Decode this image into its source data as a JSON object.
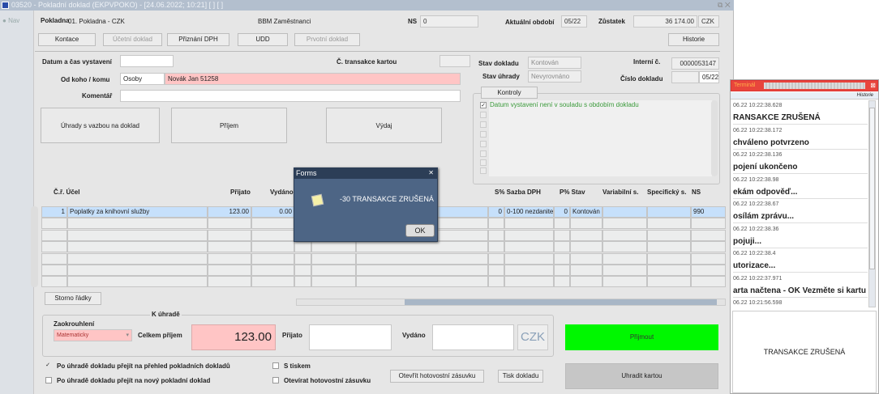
{
  "window": {
    "title": "03520 - Pokladní doklad (EKPVPOKO) - [24.06.2022; 10:21] [ ] [ ]",
    "nav": "Nav"
  },
  "header": {
    "pokladna_label": "Pokladna",
    "pokladna_value": "01. Pokladna - CZK",
    "group": "BBM Zaměstnanci",
    "ns_label": "NS",
    "ns_value": "0",
    "obdobi_label": "Aktuální období",
    "obdobi_value": "05/22",
    "zustatek_label": "Zůstatek",
    "zustatek_value": "36 174.00",
    "currency": "CZK"
  },
  "toolbar": {
    "kontace": "Kontace",
    "ucetni": "Účetní doklad",
    "dph": "Přiznání DPH",
    "udd": "UDD",
    "prvotni": "Prvotní doklad",
    "historie": "Historie"
  },
  "form": {
    "datum_label": "Datum a čas vystavení",
    "datum_value": "",
    "transakce_label": "Č. transakce kartou",
    "transakce_value": "",
    "od_koho_label": "Od koho / komu",
    "od_koho_type": "Osoby",
    "od_koho_value": "Novák Jan 51258",
    "komentar_label": "Komentář",
    "komentar_value": "",
    "stav_dokladu_label": "Stav dokladu",
    "stav_dokladu_value": "Kontován",
    "stav_uhrady_label": "Stav úhrady",
    "stav_uhrady_value": "Nevyrovnáno",
    "interni_label": "Interní č.",
    "interni_value": "0000053147",
    "cislo_label": "Číslo dokladu",
    "cislo_value": "05/22"
  },
  "kontroly": {
    "tab": "Kontroly",
    "items": [
      {
        "checked": true,
        "text": "Datum vystavení není v souladu s obdobím dokladu"
      }
    ]
  },
  "actions": {
    "uhrady": "Úhrady s vazbou na doklad",
    "prijem": "Příjem",
    "vydaj": "Výdaj"
  },
  "table": {
    "headers": {
      "cr_ucel": "Č.ř. Účel",
      "prijato": "Přijato",
      "vydano": "Vydáno",
      "sazba": "S% Sazba DPH",
      "stav": "P% Stav",
      "var": "Variabilní s.",
      "spec": "Specifický s.",
      "ns": "NS"
    },
    "rows": [
      {
        "cr": "1",
        "ucel": "Poplatky za knihovní služby",
        "prijato": "123.00",
        "vydano": "0.00",
        "s": "0",
        "sazba": "0-100 nezdanite",
        "p": "0",
        "stav": "Kontován",
        "var": "",
        "spec": "",
        "ns": "990"
      }
    ],
    "storno": "Storno řádky"
  },
  "payment": {
    "group_label": "K úhradě",
    "zaokrouhleni_label": "Zaokrouhlení",
    "zaokrouhleni_value": "Matematicky",
    "celkem_label": "Celkem příjem",
    "celkem_value": "123.00",
    "prijato_label": "Přijato",
    "prijato_value": "",
    "vydano_label": "Vydáno",
    "vydano_value": "",
    "currency": "CZK",
    "prijmout": "Přijmout",
    "uhradit": "Uhradit kartou",
    "opt1": "Po úhradě dokladu přejít na přehled pokladních dokladů",
    "opt2": "Po úhradě dokladu přejít na nový pokladní doklad",
    "opt3": "S tiskem",
    "opt4": "Otevírat hotovostní zásuvku",
    "zasuvka": "Otevřít hotovostní zásuvku",
    "tisk": "Tisk dokladu"
  },
  "dialog": {
    "title": "Forms",
    "message": "-30 TRANSAKCE ZRUŠENÁ",
    "ok": "OK"
  },
  "terminal": {
    "title": "Terminál",
    "historie": "Historie",
    "entries": [
      {
        "ts": "06.22 10:22:38.628",
        "msg": "RANSAKCE ZRUŠENÁ"
      },
      {
        "ts": "06.22 10:22:38.172",
        "msg": "chváleno potvrzeno"
      },
      {
        "ts": "06.22 10:22:38.136",
        "msg": "pojení ukončeno"
      },
      {
        "ts": "06.22 10:22:38.98",
        "msg": "ekám odpověď..."
      },
      {
        "ts": "06.22 10:22:38.67",
        "msg": "osílám zprávu..."
      },
      {
        "ts": "06.22 10:22:38.36",
        "msg": "pojuji..."
      },
      {
        "ts": "06.22 10:22:38.4",
        "msg": "utorizace..."
      },
      {
        "ts": "06.22 10:22:37.971",
        "msg": "arta načtena - OK Vezměte si kartu"
      },
      {
        "ts": "06.22 10:21:56.598",
        "msg": ""
      }
    ],
    "status": "TRANSAKCE ZRUŠENÁ"
  },
  "colors": {
    "accent_green": "#00f700",
    "pink": "#ffc5c5",
    "selected_row": "#c6e0fb",
    "dialog": "#4d6585",
    "terminal_red": "#e8453c"
  }
}
